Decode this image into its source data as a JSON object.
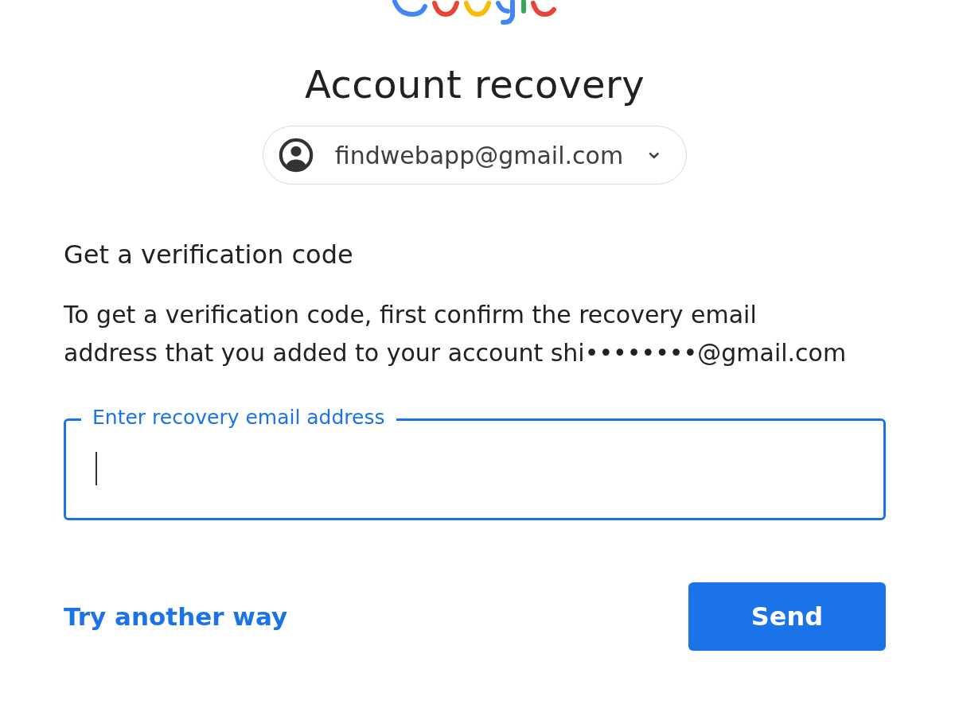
{
  "title": "Account recovery",
  "account": {
    "email": "findwebapp@gmail.com",
    "caret": "⌄"
  },
  "heading": "Get a verification code",
  "description": "To get a verification code, first confirm the recovery email address that you added to your account shi••••••••@gmail.com",
  "field": {
    "label": "Enter recovery email address",
    "focused": true
  },
  "link": "Try another way",
  "button": "Send"
}
